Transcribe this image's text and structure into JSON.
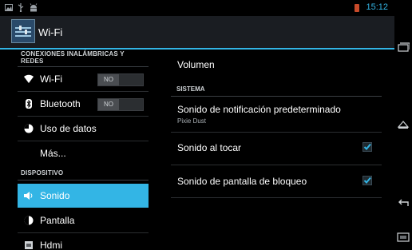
{
  "status_bar": {
    "time": "15:12",
    "icons": [
      "gallery-icon",
      "usb-icon",
      "android-icon",
      "battery-icon"
    ]
  },
  "action_bar": {
    "title": "Wi-Fi",
    "icon": "wifi-settings-icon"
  },
  "left_pane": {
    "category_wireless": "CONEXIONES INALÁMBRICAS Y REDES",
    "category_device": "DISPOSITIVO",
    "items": [
      {
        "label": "Wi-Fi",
        "icon": "wifi-icon",
        "toggle": "NO"
      },
      {
        "label": "Bluetooth",
        "icon": "bluetooth-icon",
        "toggle": "NO"
      },
      {
        "label": "Uso de datos",
        "icon": "data-usage-icon"
      },
      {
        "label": "Más..."
      },
      {
        "label": "Sonido",
        "icon": "speaker-icon",
        "selected": true
      },
      {
        "label": "Pantalla",
        "icon": "display-icon"
      },
      {
        "label": "Hdmi",
        "icon": "hdmi-icon"
      }
    ]
  },
  "right_pane": {
    "volume_label": "Volumen",
    "category_system": "SISTEMA",
    "notification_sound": {
      "label": "Sonido de notificación predeterminado",
      "value": "Pixie Dust"
    },
    "touch_sound": {
      "label": "Sonido al tocar",
      "checked": true
    },
    "lock_sound": {
      "label": "Sonido de pantalla de bloqueo",
      "checked": true
    }
  },
  "nav_bar": {
    "icons": [
      "recent-apps-icon",
      "home-icon",
      "back-icon",
      "screenshot-icon"
    ]
  },
  "colors": {
    "accent": "#33b5e5",
    "background": "#000000",
    "battery": "#c84a2a"
  }
}
